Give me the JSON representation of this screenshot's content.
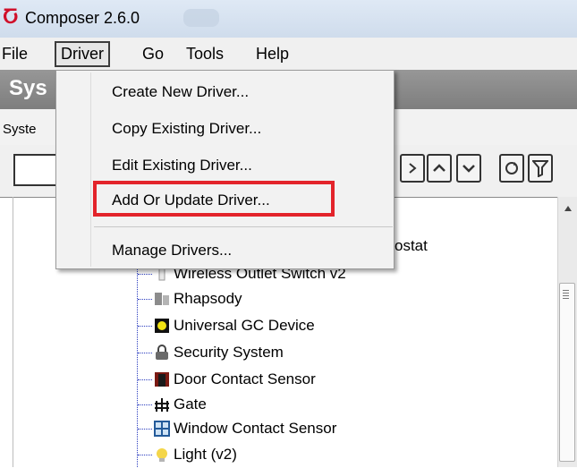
{
  "window": {
    "title": "Composer 2.6.0"
  },
  "menubar": {
    "items": [
      "File",
      "Driver",
      "Go",
      "Tools",
      "Help"
    ]
  },
  "header": {
    "title_fragment": "Sys"
  },
  "sysrow": {
    "label_fragment": "Syste"
  },
  "dropdown": {
    "items": [
      "Create New Driver...",
      "Copy Existing Driver...",
      "Edit Existing Driver...",
      "Add Or Update Driver...",
      "Manage Drivers..."
    ],
    "highlighted": "Add Or Update Driver..."
  },
  "tree": {
    "partial_label": "ostat",
    "items": [
      {
        "label": "Wireless Outlet Switch v2",
        "icon": "outlet-switch-icon"
      },
      {
        "label": "Rhapsody",
        "icon": "rhapsody-icon"
      },
      {
        "label": "Universal GC Device",
        "icon": "gc-device-icon"
      },
      {
        "label": "Security System",
        "icon": "security-lock-icon"
      },
      {
        "label": "Door Contact Sensor",
        "icon": "door-sensor-icon"
      },
      {
        "label": "Gate",
        "icon": "gate-icon"
      },
      {
        "label": "Window Contact Sensor",
        "icon": "window-sensor-icon"
      },
      {
        "label": "Light (v2)",
        "icon": "light-icon"
      }
    ]
  },
  "colors": {
    "highlight": "#e3242b",
    "tree_lines": "#2a3cbf",
    "header_band": "#8a8a8a"
  }
}
